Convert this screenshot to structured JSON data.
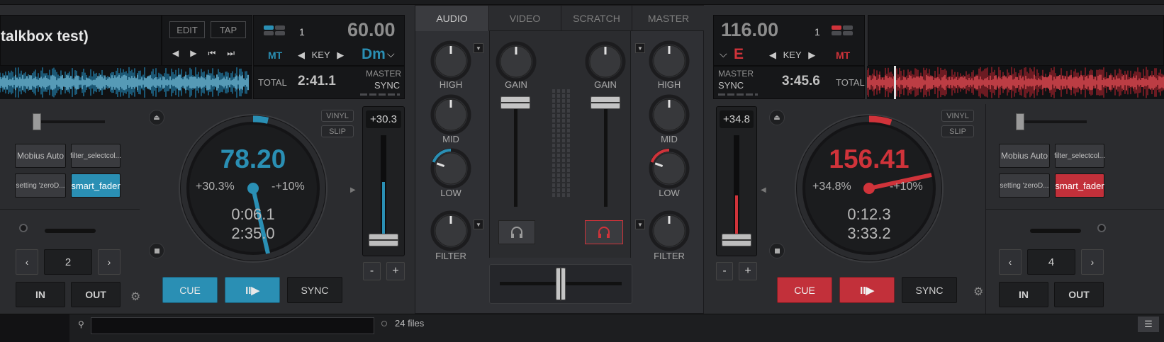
{
  "deck1": {
    "title": "talkbox test)",
    "edit_label": "EDIT",
    "tap_label": "TAP",
    "deck_number": "1",
    "bpm": "60.00",
    "mt_label": "MT",
    "key_label": "KEY",
    "key_value": "Dm",
    "total_label": "TOTAL",
    "total_time": "2:41.1",
    "master_label": "MASTER",
    "sync_label": "SYNC",
    "fx1": "Mobius Auto",
    "fx2": "filter_selectcol...",
    "fx3": "setting 'zeroD...",
    "fx4": "smart_fader",
    "loop_value": "2",
    "in_label": "IN",
    "out_label": "OUT",
    "vinyl_label": "VINYL",
    "slip_label": "SLIP",
    "jog_bpm": "78.20",
    "pitch_pct": "+30.3%",
    "pitch_range": "-+10%",
    "elapsed": "0:06.1",
    "remaining": "2:35.0",
    "pitch_display": "+30.3",
    "minus": "-",
    "plus": "+",
    "cue_label": "CUE",
    "play_label": "II▶",
    "sync_btn": "SYNC",
    "accent": "#2a8fb4",
    "pitch_level": 0.55
  },
  "deck2": {
    "bpm": "116.00",
    "deck_number": "1",
    "key_value": "E",
    "key_label": "KEY",
    "mt_label": "MT",
    "master_label": "MASTER",
    "sync_label": "SYNC",
    "total_time": "3:45.6",
    "total_label": "TOTAL",
    "fx1": "Mobius Auto",
    "fx2": "filter_selectcol...",
    "fx3": "setting 'zeroD...",
    "fx4": "smart_fader",
    "loop_value": "4",
    "in_label": "IN",
    "out_label": "OUT",
    "vinyl_label": "VINYL",
    "slip_label": "SLIP",
    "jog_bpm": "156.41",
    "pitch_pct": "+34.8%",
    "pitch_range": "-+10%",
    "elapsed": "0:12.3",
    "remaining": "3:33.2",
    "pitch_display": "+34.8",
    "minus": "-",
    "plus": "+",
    "cue_label": "CUE",
    "play_label": "II▶",
    "sync_btn": "SYNC",
    "accent": "#d0333a",
    "pitch_level": 0.42
  },
  "mixer": {
    "tabs": [
      "AUDIO",
      "VIDEO",
      "SCRATCH",
      "MASTER"
    ],
    "high": "HIGH",
    "mid": "MID",
    "low": "LOW",
    "filter": "FILTER",
    "gain": "GAIN"
  },
  "browser": {
    "file_count": "24 files"
  }
}
